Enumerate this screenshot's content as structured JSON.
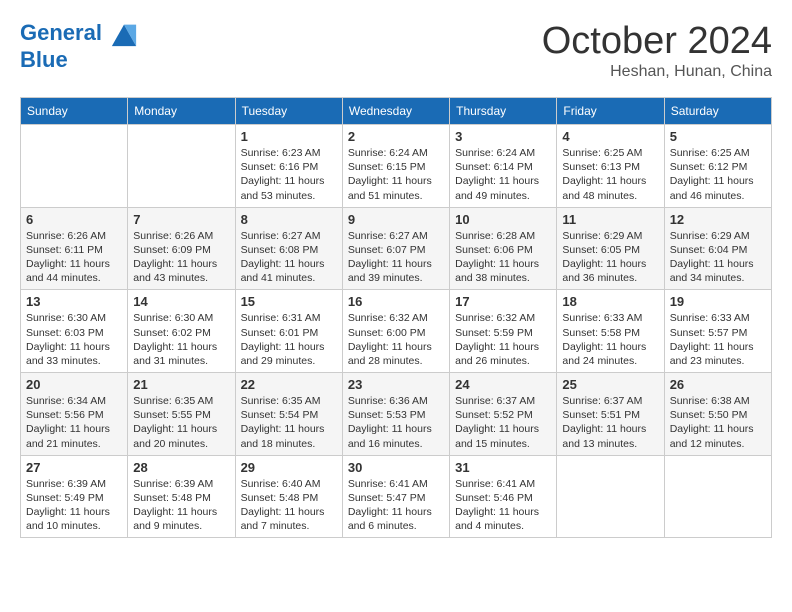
{
  "header": {
    "logo_line1": "General",
    "logo_line2": "Blue",
    "month": "October 2024",
    "location": "Heshan, Hunan, China"
  },
  "days_of_week": [
    "Sunday",
    "Monday",
    "Tuesday",
    "Wednesday",
    "Thursday",
    "Friday",
    "Saturday"
  ],
  "weeks": [
    [
      {
        "day": "",
        "info": ""
      },
      {
        "day": "",
        "info": ""
      },
      {
        "day": "1",
        "info": "Sunrise: 6:23 AM\nSunset: 6:16 PM\nDaylight: 11 hours and 53 minutes."
      },
      {
        "day": "2",
        "info": "Sunrise: 6:24 AM\nSunset: 6:15 PM\nDaylight: 11 hours and 51 minutes."
      },
      {
        "day": "3",
        "info": "Sunrise: 6:24 AM\nSunset: 6:14 PM\nDaylight: 11 hours and 49 minutes."
      },
      {
        "day": "4",
        "info": "Sunrise: 6:25 AM\nSunset: 6:13 PM\nDaylight: 11 hours and 48 minutes."
      },
      {
        "day": "5",
        "info": "Sunrise: 6:25 AM\nSunset: 6:12 PM\nDaylight: 11 hours and 46 minutes."
      }
    ],
    [
      {
        "day": "6",
        "info": "Sunrise: 6:26 AM\nSunset: 6:11 PM\nDaylight: 11 hours and 44 minutes."
      },
      {
        "day": "7",
        "info": "Sunrise: 6:26 AM\nSunset: 6:09 PM\nDaylight: 11 hours and 43 minutes."
      },
      {
        "day": "8",
        "info": "Sunrise: 6:27 AM\nSunset: 6:08 PM\nDaylight: 11 hours and 41 minutes."
      },
      {
        "day": "9",
        "info": "Sunrise: 6:27 AM\nSunset: 6:07 PM\nDaylight: 11 hours and 39 minutes."
      },
      {
        "day": "10",
        "info": "Sunrise: 6:28 AM\nSunset: 6:06 PM\nDaylight: 11 hours and 38 minutes."
      },
      {
        "day": "11",
        "info": "Sunrise: 6:29 AM\nSunset: 6:05 PM\nDaylight: 11 hours and 36 minutes."
      },
      {
        "day": "12",
        "info": "Sunrise: 6:29 AM\nSunset: 6:04 PM\nDaylight: 11 hours and 34 minutes."
      }
    ],
    [
      {
        "day": "13",
        "info": "Sunrise: 6:30 AM\nSunset: 6:03 PM\nDaylight: 11 hours and 33 minutes."
      },
      {
        "day": "14",
        "info": "Sunrise: 6:30 AM\nSunset: 6:02 PM\nDaylight: 11 hours and 31 minutes."
      },
      {
        "day": "15",
        "info": "Sunrise: 6:31 AM\nSunset: 6:01 PM\nDaylight: 11 hours and 29 minutes."
      },
      {
        "day": "16",
        "info": "Sunrise: 6:32 AM\nSunset: 6:00 PM\nDaylight: 11 hours and 28 minutes."
      },
      {
        "day": "17",
        "info": "Sunrise: 6:32 AM\nSunset: 5:59 PM\nDaylight: 11 hours and 26 minutes."
      },
      {
        "day": "18",
        "info": "Sunrise: 6:33 AM\nSunset: 5:58 PM\nDaylight: 11 hours and 24 minutes."
      },
      {
        "day": "19",
        "info": "Sunrise: 6:33 AM\nSunset: 5:57 PM\nDaylight: 11 hours and 23 minutes."
      }
    ],
    [
      {
        "day": "20",
        "info": "Sunrise: 6:34 AM\nSunset: 5:56 PM\nDaylight: 11 hours and 21 minutes."
      },
      {
        "day": "21",
        "info": "Sunrise: 6:35 AM\nSunset: 5:55 PM\nDaylight: 11 hours and 20 minutes."
      },
      {
        "day": "22",
        "info": "Sunrise: 6:35 AM\nSunset: 5:54 PM\nDaylight: 11 hours and 18 minutes."
      },
      {
        "day": "23",
        "info": "Sunrise: 6:36 AM\nSunset: 5:53 PM\nDaylight: 11 hours and 16 minutes."
      },
      {
        "day": "24",
        "info": "Sunrise: 6:37 AM\nSunset: 5:52 PM\nDaylight: 11 hours and 15 minutes."
      },
      {
        "day": "25",
        "info": "Sunrise: 6:37 AM\nSunset: 5:51 PM\nDaylight: 11 hours and 13 minutes."
      },
      {
        "day": "26",
        "info": "Sunrise: 6:38 AM\nSunset: 5:50 PM\nDaylight: 11 hours and 12 minutes."
      }
    ],
    [
      {
        "day": "27",
        "info": "Sunrise: 6:39 AM\nSunset: 5:49 PM\nDaylight: 11 hours and 10 minutes."
      },
      {
        "day": "28",
        "info": "Sunrise: 6:39 AM\nSunset: 5:48 PM\nDaylight: 11 hours and 9 minutes."
      },
      {
        "day": "29",
        "info": "Sunrise: 6:40 AM\nSunset: 5:48 PM\nDaylight: 11 hours and 7 minutes."
      },
      {
        "day": "30",
        "info": "Sunrise: 6:41 AM\nSunset: 5:47 PM\nDaylight: 11 hours and 6 minutes."
      },
      {
        "day": "31",
        "info": "Sunrise: 6:41 AM\nSunset: 5:46 PM\nDaylight: 11 hours and 4 minutes."
      },
      {
        "day": "",
        "info": ""
      },
      {
        "day": "",
        "info": ""
      }
    ]
  ]
}
